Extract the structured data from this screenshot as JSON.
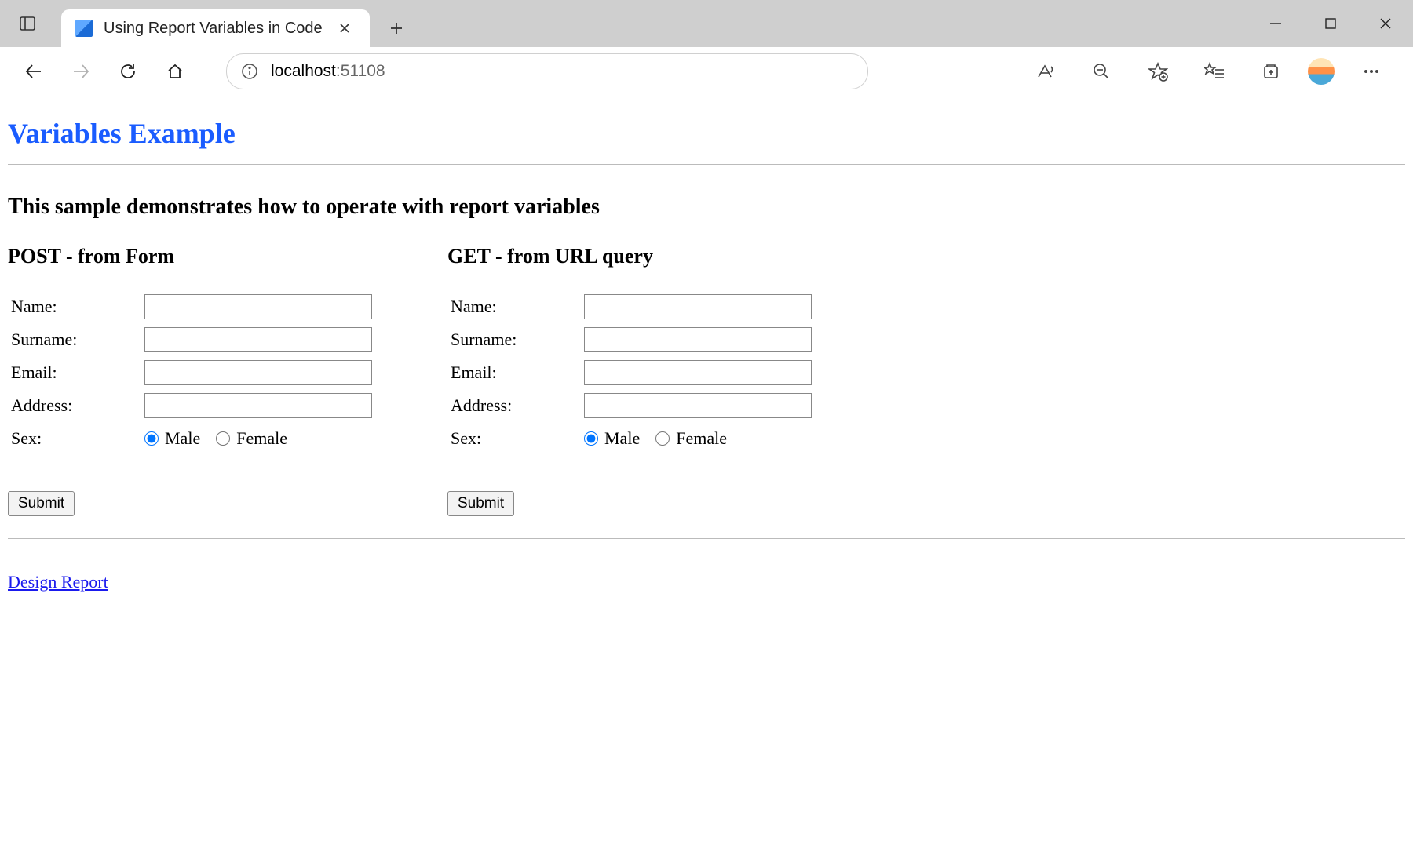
{
  "browser": {
    "tab_title": "Using Report Variables in Code",
    "url_host": "localhost",
    "url_port": ":51108"
  },
  "page": {
    "heading": "Variables Example",
    "subheading": "This sample demonstrates how to operate with report variables",
    "design_link": "Design Report"
  },
  "forms": {
    "post": {
      "title": "POST - from Form",
      "labels": {
        "name": "Name:",
        "surname": "Surname:",
        "email": "Email:",
        "address": "Address:",
        "sex": "Sex:"
      },
      "sex_options": {
        "male": "Male",
        "female": "Female"
      },
      "submit": "Submit"
    },
    "get": {
      "title": "GET - from URL query",
      "labels": {
        "name": "Name:",
        "surname": "Surname:",
        "email": "Email:",
        "address": "Address:",
        "sex": "Sex:"
      },
      "sex_options": {
        "male": "Male",
        "female": "Female"
      },
      "submit": "Submit"
    }
  }
}
